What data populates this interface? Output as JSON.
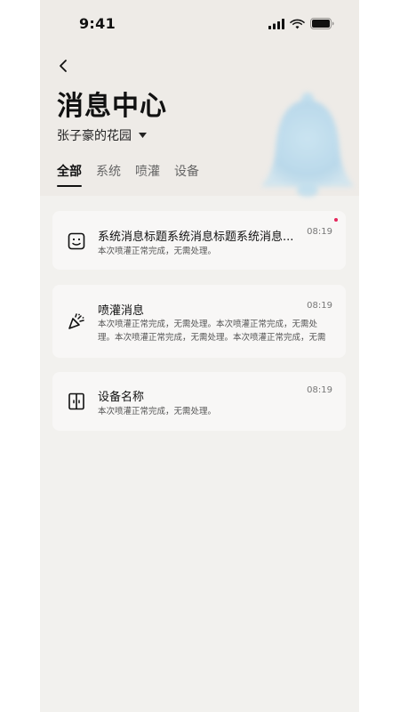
{
  "status_bar": {
    "time": "9:41"
  },
  "header": {
    "back_icon": "chevron-left-icon",
    "title": "消息中心",
    "garden_name": "张子豪的花园",
    "garden_dropdown_icon": "caret-down-icon",
    "decoration_icon": "bell-icon"
  },
  "tabs": [
    {
      "label": "全部",
      "active": true
    },
    {
      "label": "系统",
      "active": false
    },
    {
      "label": "喷灌",
      "active": false
    },
    {
      "label": "设备",
      "active": false
    }
  ],
  "messages": [
    {
      "icon": "system-message-icon",
      "title": "系统消息标题系统消息标题系统消息...",
      "time": "08:19",
      "description": "本次喷灌正常完成，无需处理。",
      "unread": true
    },
    {
      "icon": "irrigation-spray-icon",
      "title": "喷灌消息",
      "time": "08:19",
      "description": "本次喷灌正常完成，无需处理。本次喷灌正常完成，无需处理。本次喷灌正常完成，无需处理。本次喷灌正常完成，无需处理。本次喷灌正常完成，无...",
      "unread": false
    },
    {
      "icon": "device-icon",
      "title": "设备名称",
      "time": "08:19",
      "description": "本次喷灌正常完成，无需处理。",
      "unread": false
    }
  ],
  "colors": {
    "background": "#f2f1ee",
    "header_background": "#eeebe7",
    "card_background": "#f8f7f6",
    "unread_dot": "#e5265b",
    "bell_decoration": "#a9d3ec"
  }
}
